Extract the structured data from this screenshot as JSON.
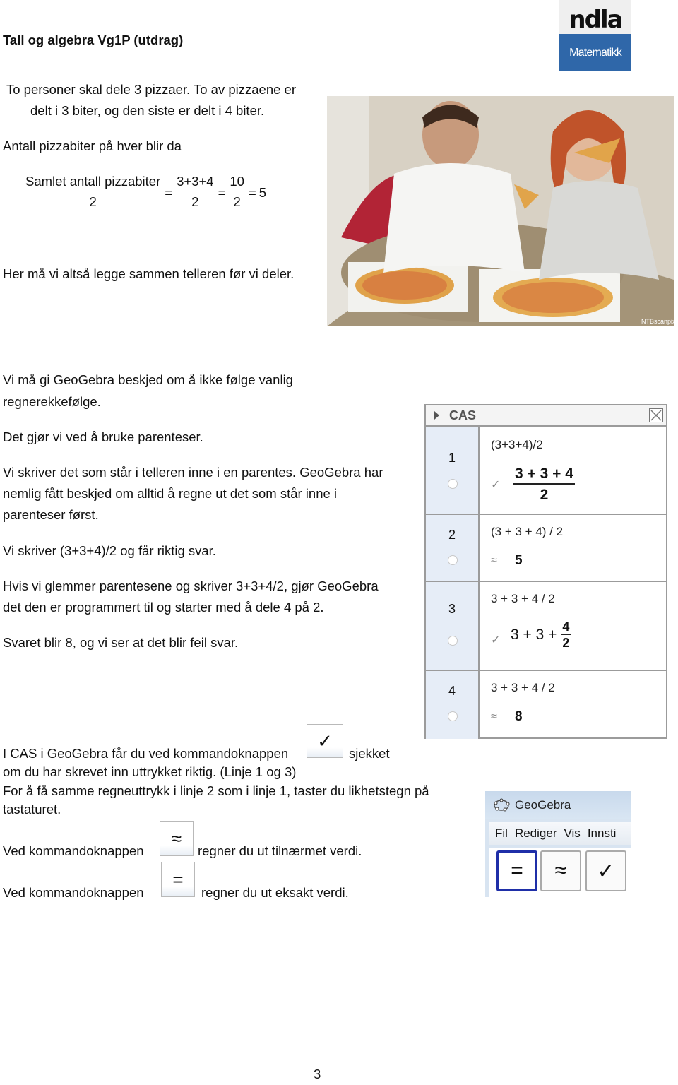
{
  "header": {
    "title": "Tall og algebra Vg1P (utdrag)",
    "logo": {
      "top": "ndla",
      "bottom": "Matematikk",
      "color": "#2f67a9"
    }
  },
  "intro": {
    "line1": "To personer skal dele 3 pizzaer. To av pizzaene er",
    "line2": "delt i 3 biter, og den siste er delt i 4 biter.",
    "line3": "Antall pizzabiter på hver blir da"
  },
  "formula": {
    "frac1_num": "Samlet antall pizzabiter",
    "frac1_den": "2",
    "eq1": "=",
    "frac2_num": "3+3+4",
    "frac2_den": "2",
    "eq2": "=",
    "frac3_num": "10",
    "frac3_den": "2",
    "eq3": "=",
    "result": "5"
  },
  "photo": {
    "description": "Two people eating pizza from boxes",
    "watermark": "NTBscanpix"
  },
  "paragraphs": {
    "p1": "Her må vi altså legge sammen telleren før vi deler.",
    "p2a": "Vi må gi GeoGebra beskjed om å ikke følge vanlig",
    "p2b": "regnerekkefølge.",
    "p3": "Det gjør vi ved å bruke parenteser.",
    "p4a": "Vi skriver det som står i telleren inne i en parentes. GeoGebra har",
    "p4b": "nemlig fått beskjed om alltid å regne ut det som står inne i",
    "p4c": "parenteser først.",
    "p5": "Vi skriver (3+3+4)/2 og får riktig svar.",
    "p6a": "Hvis vi  glemmer parentesene og skriver 3+3+4/2, gjør GeoGebra",
    "p6b": "det den er programmert til og starter med å dele 4 på 2.",
    "p7": "Svaret blir 8, og vi ser at det blir feil svar."
  },
  "cas": {
    "title": "CAS",
    "rows": [
      {
        "n": "1",
        "input": "(3+3+4)/2",
        "mark": "✓",
        "out_num": "3 + 3 + 4",
        "out_den": "2"
      },
      {
        "n": "2",
        "input": "(3 + 3 + 4) / 2",
        "mark": "≈",
        "out": "5"
      },
      {
        "n": "3",
        "input": "3 + 3 + 4 / 2",
        "mark": "✓",
        "out_prefix": "3 + 3 +",
        "out_num": "4",
        "out_den": "2"
      },
      {
        "n": "4",
        "input": "3 + 3 + 4 / 2",
        "mark": "≈",
        "out": "8"
      }
    ]
  },
  "bottom": {
    "b1a": "I CAS i GeoGebra får du ved kommandoknappen",
    "b1b": "sjekket",
    "b2": "om du har skrevet inn uttrykket riktig. (Linje 1 og 3)",
    "b3": "For å få samme regneuttrykk i linje 2 som i linje 1, taster du likhetstegn på",
    "b4": "tastaturet.",
    "b5a": "Ved kommandoknappen",
    "b5b": "regner du ut tilnærmet verdi.",
    "b6a": "Ved kommandoknappen",
    "b6b": "regner du ut eksakt verdi.",
    "check_glyph": "✓",
    "approx_glyph": "≈",
    "equal_glyph": "="
  },
  "ggb": {
    "app_title": "GeoGebra",
    "menu": [
      "Fil",
      "Rediger",
      "Vis",
      "Innsti"
    ],
    "tools": [
      "=",
      "≈",
      "✓"
    ]
  },
  "footer": {
    "page_number": "3"
  }
}
